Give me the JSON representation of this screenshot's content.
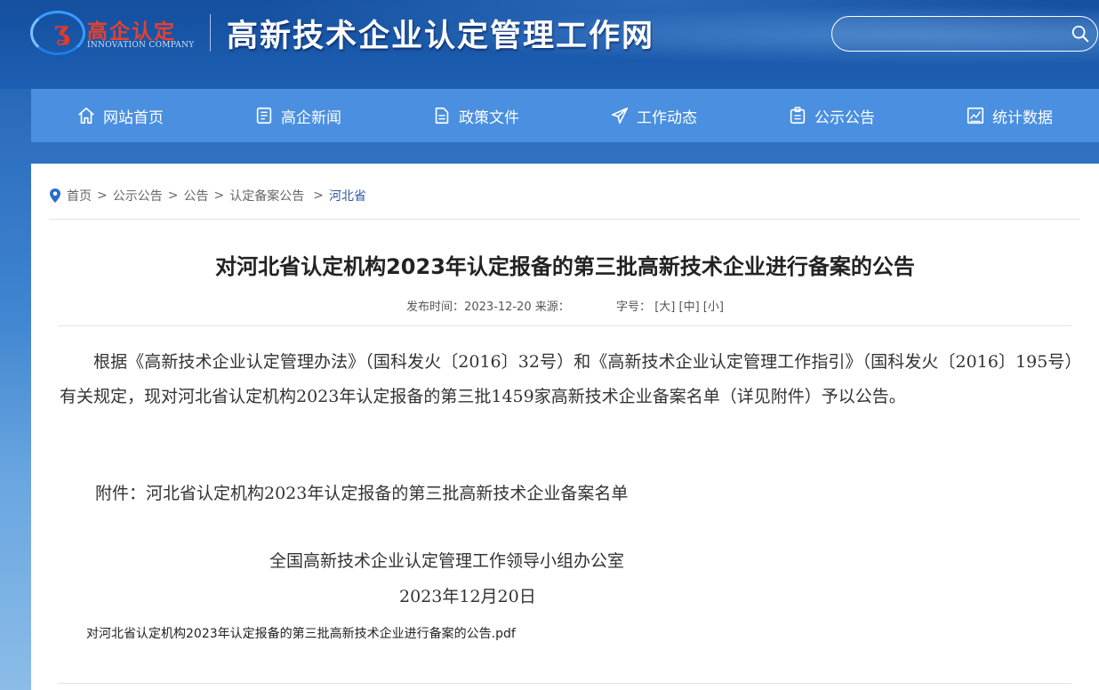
{
  "header": {
    "logo_cn": "高企认定",
    "logo_en": "INNOVATION COMPANY",
    "site_title": "高新技术企业认定管理工作网",
    "search_placeholder": ""
  },
  "nav": [
    {
      "label": "网站首页",
      "icon": "home-icon"
    },
    {
      "label": "高企新闻",
      "icon": "news-icon"
    },
    {
      "label": "政策文件",
      "icon": "document-icon"
    },
    {
      "label": "工作动态",
      "icon": "paper-plane-icon"
    },
    {
      "label": "公示公告",
      "icon": "notice-icon"
    },
    {
      "label": "统计数据",
      "icon": "chart-icon"
    }
  ],
  "breadcrumb": {
    "items": [
      "首页",
      "公示公告",
      "公告",
      "认定备案公告",
      "河北省"
    ],
    "separator": ">"
  },
  "article": {
    "title": "对河北省认定机构2023年认定报备的第三批高新技术企业进行备案的公告",
    "publish_label": "发布时间：",
    "publish_date": "2023-12-20",
    "source_label": "来源：",
    "font_size_label": "字号：",
    "font_large": "[大]",
    "font_medium": "[中]",
    "font_small": "[小]",
    "paragraph": "根据《高新技术企业认定管理办法》（国科发火〔2016〕32号）和《高新技术企业认定管理工作指引》（国科发火〔2016〕195号）有关规定，现对河北省认定机构2023年认定报备的第三批1459家高新技术企业备案名单（详见附件）予以公告。",
    "attachment": "附件：河北省认定机构2023年认定报备的第三批高新技术企业备案名单",
    "signature_org": "全国高新技术企业认定管理工作领导小组办公室",
    "signature_date": "2023年12月20日",
    "pdf_link": "对河北省认定机构2023年认定报备的第三批高新技术企业进行备案的公告.pdf"
  },
  "colors": {
    "nav_bg": "#4a8fe0",
    "header_bg": "#1d5fb3",
    "logo_red": "#e8402e",
    "breadcrumb_current": "#2a5aa8"
  }
}
